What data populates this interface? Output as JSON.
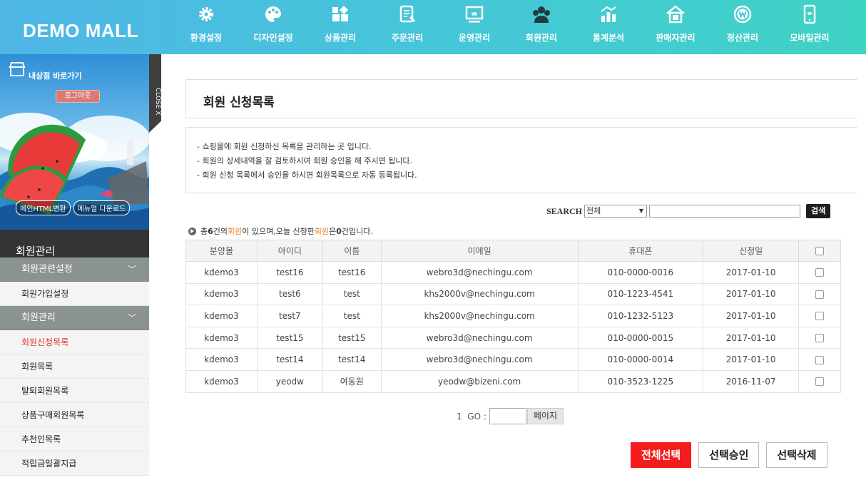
{
  "header": {
    "logo": "DEMO MALL",
    "nav": [
      {
        "label": "환경설정",
        "icon": "gear-icon"
      },
      {
        "label": "디자인설정",
        "icon": "palette-icon"
      },
      {
        "label": "상품관리",
        "icon": "product-grid-icon"
      },
      {
        "label": "주문관리",
        "icon": "order-form-icon"
      },
      {
        "label": "운영관리",
        "icon": "monitor-icon"
      },
      {
        "label": "회원관리",
        "icon": "members-icon"
      },
      {
        "label": "통계분석",
        "icon": "stats-icon"
      },
      {
        "label": "판매자관리",
        "icon": "shop-icon"
      },
      {
        "label": "정산관리",
        "icon": "won-coin-icon"
      },
      {
        "label": "모바일관리",
        "icon": "mobile-icon"
      }
    ]
  },
  "sidebar": {
    "store_link": "내상점 바로가기",
    "logout": "로그아웃",
    "close_tab": "CLOSE X",
    "html_btn": "메인HTML변환",
    "manual_btn": "메뉴얼 다운로드",
    "section_title": "회원관리",
    "menu": [
      {
        "type": "group",
        "label": "회원관련설정",
        "chevron": "﹀"
      },
      {
        "type": "sub",
        "label": "회원가입설정"
      },
      {
        "type": "group",
        "label": "회원관리",
        "chevron": "﹀"
      },
      {
        "type": "sub",
        "label": "회원신청목록",
        "active": true
      },
      {
        "type": "sub",
        "label": "회원목록"
      },
      {
        "type": "sub",
        "label": "탈퇴회원목록"
      },
      {
        "type": "sub",
        "label": "상품구매회원목록"
      },
      {
        "type": "sub",
        "label": "추천인목록"
      },
      {
        "type": "sub",
        "label": "적립금일괄지급"
      }
    ]
  },
  "main": {
    "title": "회원 신청목록",
    "notices": [
      "- 쇼핑몰에 회원 신청하신 목록을 관리하는 곳 입니다.",
      "- 회원의 상세내역을 잘 검토하시여 회원 승인을 해 주시면 됩니다.",
      "- 회원 신청 목록에서 승인을 하시면 회원목록으로 자동 등록됩니다."
    ],
    "search": {
      "label": "SEARCH",
      "select_value": "전체",
      "button": "검색"
    },
    "summary": {
      "p1": "총 ",
      "total": "6",
      "p2": "건의 ",
      "w1": "회원",
      "p3": "이 있으며,오늘 신청한 ",
      "w2": "회원",
      "p4": "은 ",
      "today": "0",
      "p5": "건입니다."
    },
    "columns": [
      "분양몰",
      "아이디",
      "이름",
      "이메일",
      "휴대폰",
      "신청일"
    ],
    "rows": [
      [
        "kdemo3",
        "test16",
        "test16",
        "webro3d@nechingu.com",
        "010-0000-0016",
        "2017-01-10"
      ],
      [
        "kdemo3",
        "test6",
        "test",
        "khs2000v@nechingu.com",
        "010-1223-4541",
        "2017-01-10"
      ],
      [
        "kdemo3",
        "test7",
        "test",
        "khs2000v@nechingu.com",
        "010-1232-5123",
        "2017-01-10"
      ],
      [
        "kdemo3",
        "test15",
        "test15",
        "webro3d@nechingu.com",
        "010-0000-0015",
        "2017-01-10"
      ],
      [
        "kdemo3",
        "test14",
        "test14",
        "webro3d@nechingu.com",
        "010-0000-0014",
        "2017-01-10"
      ],
      [
        "kdemo3",
        "yeodw",
        "여동원",
        "yeodw@bizeni.com",
        "010-3523-1225",
        "2016-11-07"
      ]
    ],
    "pager": {
      "page": "1",
      "go_label": "GO :",
      "button": "페이지"
    },
    "actions": {
      "select_all": "전체선택",
      "approve": "선택승인",
      "delete": "선택삭제"
    }
  },
  "colors": {
    "accent_red": "#f41c1c",
    "highlight_orange": "#e9881a",
    "header_start": "#4fb6e6",
    "header_end": "#3fd3c4"
  }
}
